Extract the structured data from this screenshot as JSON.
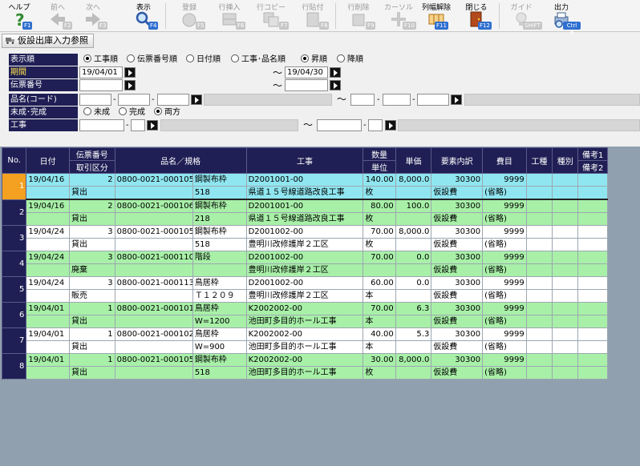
{
  "toolbar": {
    "help": {
      "label": "ヘルプ",
      "key": "F1"
    },
    "prev": {
      "label": "前へ",
      "key": "F2"
    },
    "next": {
      "label": "次へ",
      "key": "F3"
    },
    "show": {
      "label": "表示",
      "key": "F4"
    },
    "register": {
      "label": "登録",
      "key": "F5"
    },
    "row_insert": {
      "label": "行挿入",
      "key": "F6"
    },
    "row_copy": {
      "label": "行コピー",
      "key": "F7"
    },
    "row_paste": {
      "label": "行貼付",
      "key": "F8"
    },
    "row_delete": {
      "label": "行削除",
      "key": "F9"
    },
    "cursor": {
      "label": "カーソル",
      "key": "F10"
    },
    "col_release": {
      "label": "列幅解除",
      "key": "F11"
    },
    "close": {
      "label": "閉じる",
      "key": "F12"
    },
    "guide": {
      "label": "ガイド",
      "key": "SHIFT"
    },
    "output": {
      "label": "出力",
      "key": "Ctrl P"
    }
  },
  "title_tab": "仮設出庫入力参照",
  "filter": {
    "order_label": "表示順",
    "order_options": [
      "工事順",
      "伝票番号順",
      "日付順",
      "工事･品名順"
    ],
    "order_selected": 0,
    "sort_options": [
      "昇順",
      "降順"
    ],
    "sort_selected": 0,
    "period_label": "期間",
    "period_from": "19/04/01",
    "period_to": "19/04/30",
    "slip_label": "伝票番号",
    "item_label": "品名(コード)",
    "status_label": "未成･完成",
    "status_options": [
      "未成",
      "完成",
      "両方"
    ],
    "status_selected": 2,
    "work_label": "工事",
    "tilde": "～",
    "dash": "-"
  },
  "grid": {
    "headers": {
      "no": "No.",
      "date": "日付",
      "slip_no": "伝票番号",
      "txn_type": "取引区分",
      "item": "品名／規格",
      "work": "工事",
      "qty": "数量",
      "unit": "単位",
      "price": "単価",
      "element": "要素内訳",
      "cost_item": "費目",
      "work_type": "工種",
      "kind": "種別",
      "note1": "備考1",
      "note2": "備考2"
    },
    "rows": [
      {
        "no": "1",
        "date": "19/04/16",
        "slip": "2",
        "code": "0800-0021-000105",
        "item": "鋼製布枠",
        "work_code": "D2001001-00",
        "qty": "140.00",
        "price": "8,000.0",
        "element_code": "30300",
        "cost_code": "9999",
        "txn": "貸出",
        "spec": "518",
        "work_name": "県道１５号線道路改良工事",
        "unit": "枚",
        "element": "仮設費",
        "cost": "(省略)"
      },
      {
        "no": "2",
        "date": "19/04/16",
        "slip": "2",
        "code": "0800-0021-000106",
        "item": "鋼製布枠",
        "work_code": "D2001001-00",
        "qty": "80.00",
        "price": "100.0",
        "element_code": "30300",
        "cost_code": "9999",
        "txn": "貸出",
        "spec": "218",
        "work_name": "県道１５号線道路改良工事",
        "unit": "枚",
        "element": "仮設費",
        "cost": "(省略)"
      },
      {
        "no": "3",
        "date": "19/04/24",
        "slip": "3",
        "code": "0800-0021-000105",
        "item": "鋼製布枠",
        "work_code": "D2001002-00",
        "qty": "70.00",
        "price": "8,000.0",
        "element_code": "30300",
        "cost_code": "9999",
        "txn": "貸出",
        "spec": "518",
        "work_name": "豊明川改修護岸２工区",
        "unit": "枚",
        "element": "仮設費",
        "cost": "(省略)"
      },
      {
        "no": "4",
        "date": "19/04/24",
        "slip": "3",
        "code": "0800-0021-000110",
        "item": "階段",
        "work_code": "D2001002-00",
        "qty": "70.00",
        "price": "0.0",
        "element_code": "30300",
        "cost_code": "9999",
        "txn": "廃棄",
        "spec": "",
        "work_name": "豊明川改修護岸２工区",
        "unit": "",
        "element": "仮設費",
        "cost": "(省略)"
      },
      {
        "no": "5",
        "date": "19/04/24",
        "slip": "3",
        "code": "0800-0021-000113",
        "item": "鳥居枠",
        "work_code": "D2001002-00",
        "qty": "60.00",
        "price": "0.0",
        "element_code": "30300",
        "cost_code": "9999",
        "txn": "販売",
        "spec": "Ｔ１２０９",
        "work_name": "豊明川改修護岸２工区",
        "unit": "本",
        "element": "仮設費",
        "cost": "(省略)"
      },
      {
        "no": "6",
        "date": "19/04/01",
        "slip": "1",
        "code": "0800-0021-000101",
        "item": "鳥居枠",
        "work_code": "K2002002-00",
        "qty": "70.00",
        "price": "6.3",
        "element_code": "30300",
        "cost_code": "9999",
        "txn": "貸出",
        "spec": "W=1200",
        "work_name": "池田町多目的ホール工事",
        "unit": "本",
        "element": "仮設費",
        "cost": "(省略)"
      },
      {
        "no": "7",
        "date": "19/04/01",
        "slip": "1",
        "code": "0800-0021-000102",
        "item": "鳥居枠",
        "work_code": "K2002002-00",
        "qty": "40.00",
        "price": "5.3",
        "element_code": "30300",
        "cost_code": "9999",
        "txn": "貸出",
        "spec": "W=900",
        "work_name": "池田町多目的ホール工事",
        "unit": "本",
        "element": "仮設費",
        "cost": "(省略)"
      },
      {
        "no": "8",
        "date": "19/04/01",
        "slip": "1",
        "code": "0800-0021-000105",
        "item": "鋼製布枠",
        "work_code": "K2002002-00",
        "qty": "30.00",
        "price": "8,000.0",
        "element_code": "30300",
        "cost_code": "9999",
        "txn": "貸出",
        "spec": "518",
        "work_name": "池田町多目的ホール工事",
        "unit": "枚",
        "element": "仮設費",
        "cost": "(省略)"
      }
    ]
  }
}
